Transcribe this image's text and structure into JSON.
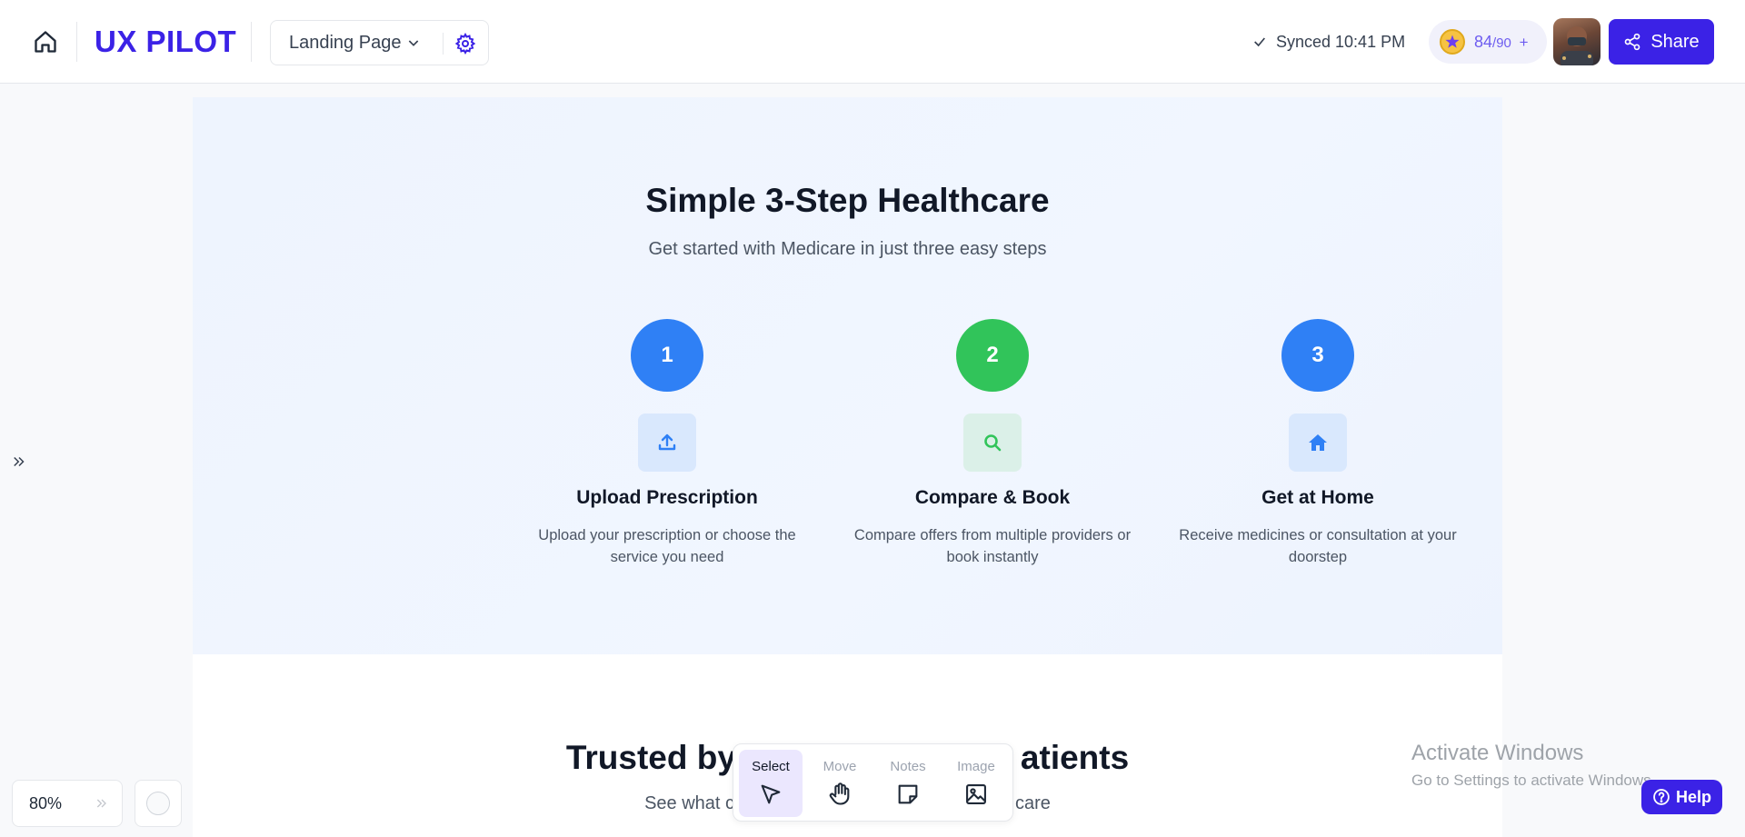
{
  "header": {
    "logo": "UX PILOT",
    "page_name": "Landing Page",
    "sync_status": "Synced 10:41 PM",
    "credits_used": "84",
    "credits_total": "/90",
    "credits_add": "+",
    "share_label": "Share"
  },
  "steps_section": {
    "title": "Simple 3-Step Healthcare",
    "subtitle": "Get started with Medicare in just three easy steps",
    "steps": [
      {
        "number": "1",
        "title": "Upload Prescription",
        "description": "Upload your prescription or choose the service you need",
        "color": "#2f80f5",
        "icon": "upload-icon"
      },
      {
        "number": "2",
        "title": "Compare & Book",
        "description": "Compare offers from multiple providers or book instantly",
        "color": "#31c45a",
        "icon": "search-icon"
      },
      {
        "number": "3",
        "title": "Get at Home",
        "description": "Receive medicines or consultation at your doorstep",
        "color": "#2f80f5",
        "icon": "home-icon"
      }
    ]
  },
  "trust_section": {
    "title_left": "Trusted by",
    "title_right": "atients",
    "subtitle_left": "See what c",
    "subtitle_right": "care"
  },
  "zoom": {
    "level": "80%"
  },
  "toolbar": {
    "tools": [
      {
        "label": "Select",
        "icon": "cursor-icon",
        "active": true
      },
      {
        "label": "Move",
        "icon": "hand-icon",
        "active": false
      },
      {
        "label": "Notes",
        "icon": "note-icon",
        "active": false
      },
      {
        "label": "Image",
        "icon": "image-icon",
        "active": false
      }
    ]
  },
  "watermark": {
    "line1": "Activate Windows",
    "line2": "Go to Settings to activate Windows."
  },
  "help": {
    "label": "Help"
  },
  "colors": {
    "brand": "#3b22e6",
    "step_blue": "#2f80f5",
    "step_green": "#31c45a"
  }
}
